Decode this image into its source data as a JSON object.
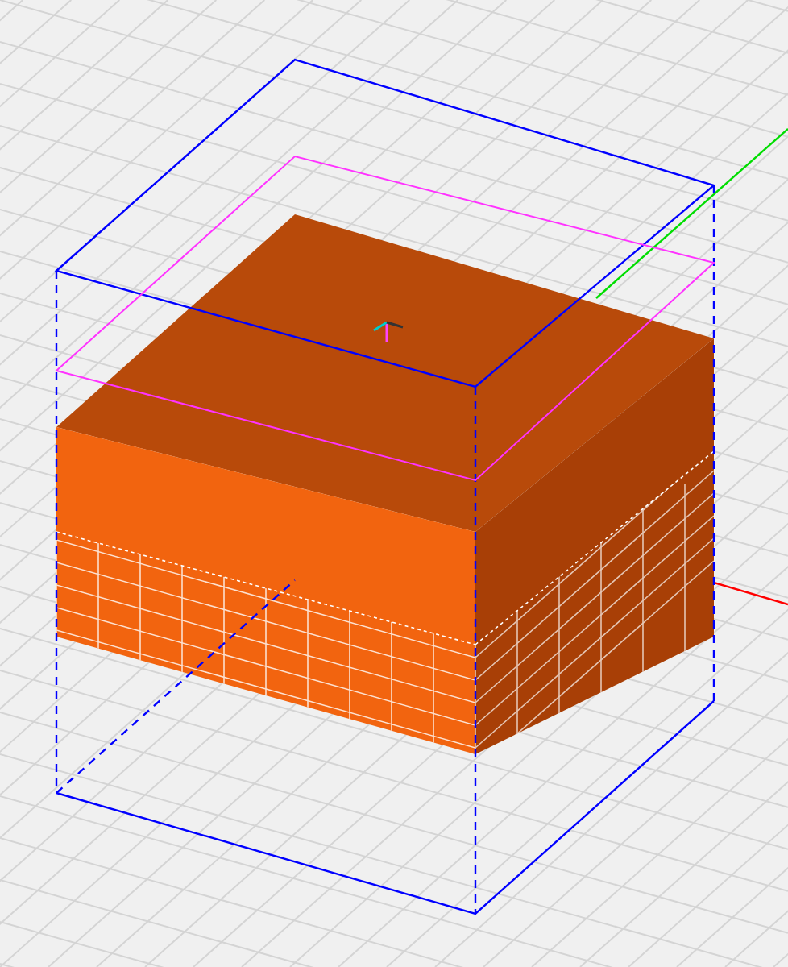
{
  "axes": [
    {
      "kind": "x",
      "color": "#ff0000"
    },
    {
      "kind": "y",
      "color": "#00dd00"
    }
  ],
  "outlines": [
    {
      "kind": "bounds",
      "color": "#0000ff"
    },
    {
      "kind": "slab",
      "color": "#ff33ff"
    }
  ]
}
